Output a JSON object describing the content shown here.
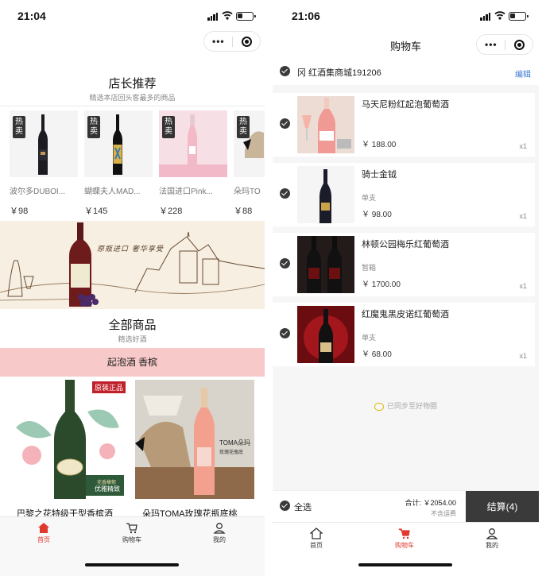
{
  "left": {
    "status": {
      "time": "21:04"
    },
    "recommend": {
      "title": "店长推荐",
      "subtitle": "精选本店回头客最多的商品",
      "products": [
        {
          "badge": "热卖",
          "name": "波尔多DUBOI...",
          "price": "￥98"
        },
        {
          "badge": "热卖",
          "name": "蝴蝶夫人MAD...",
          "price": "￥145"
        },
        {
          "badge": "热卖",
          "name": "法国进口Pink...",
          "price": "￥228"
        },
        {
          "badge": "热卖",
          "name": "朵玛TO",
          "price": "￥88"
        }
      ]
    },
    "banner": {
      "slogan": "原瓶进口 奢华享受"
    },
    "all_goods": {
      "title": "全部商品",
      "subtitle": "精选好酒"
    },
    "category_bar": {
      "label": "起泡酒 香槟"
    },
    "featured": [
      {
        "name": "巴黎之花特级干型香槟酒",
        "tag": "原装正品",
        "sticker": "优雅精致",
        "sticker_small": "花香馥郁"
      },
      {
        "name": "朵玛TOMA玫瑰花瓶底桃",
        "label": "TOMA朵玛",
        "label2": "玫瑰花瓶底"
      }
    ],
    "tabs": [
      {
        "label": "首页",
        "icon": "home-icon",
        "active": true
      },
      {
        "label": "购物车",
        "icon": "cart-icon",
        "active": false
      },
      {
        "label": "我的",
        "icon": "user-icon",
        "active": false
      }
    ]
  },
  "right": {
    "status": {
      "time": "21:06"
    },
    "title": "购物车",
    "shop": {
      "name": "冈 红酒集商城191206",
      "edit_label": "编辑"
    },
    "items": [
      {
        "name": "马天尼粉红起泡葡萄酒",
        "spec": "",
        "price": "￥ 188.00",
        "qty": "x1"
      },
      {
        "name": "骑士金钺",
        "spec": "单支",
        "price": "￥ 98.00",
        "qty": "x1"
      },
      {
        "name": "林顿公园梅乐红葡萄酒",
        "spec": "暂箱",
        "price": "￥ 1700.00",
        "qty": "x1"
      },
      {
        "name": "红魔鬼黑皮诺红葡萄酒",
        "spec": "单支",
        "price": "￥ 68.00",
        "qty": "x1"
      }
    ],
    "sync_text": "已同步至好物圈",
    "checkout": {
      "select_all": "全选",
      "total": "合计: ￥2054.00",
      "shipping": "不含运费",
      "button": "结算(4)"
    },
    "tabs": [
      {
        "label": "首页",
        "icon": "home-icon",
        "active": false
      },
      {
        "label": "购物车",
        "icon": "cart-icon",
        "active": true
      },
      {
        "label": "我的",
        "icon": "user-icon",
        "active": false
      }
    ]
  },
  "colors": {
    "accent_red": "#e03a2f",
    "category_pink": "#f8c9c9",
    "dark_button": "#3a3a3a",
    "edit_blue": "#3b7bd4"
  }
}
